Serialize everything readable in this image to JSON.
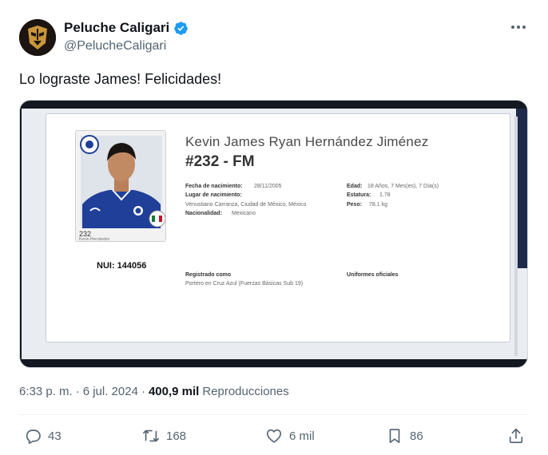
{
  "author": {
    "display_name": "Peluche Caligari",
    "handle": "@PelucheCaligari",
    "verified": true
  },
  "tweet": {
    "text": "Lo lograste James! Felicidades!"
  },
  "media": {
    "full_name": "Kevin James Ryan Hernández Jiménez",
    "number_position": "#232 - FM",
    "sticker_number": "232",
    "sticker_name": "Kevin Hernández",
    "nui": "NUI: 144056",
    "fields": {
      "birth_date_label": "Fecha de nacimiento:",
      "birth_date_value": "28/11/2005",
      "birth_place_label": "Lugar de nacimiento:",
      "birth_place_value": "Venustiano Carranza, Ciudad de México, México",
      "nationality_label": "Nacionalidad:",
      "nationality_value": "Mexicano",
      "age_label": "Edad:",
      "age_value": "18 Años, 7 Mes(es), 7 Día(s)",
      "height_label": "Estatura:",
      "height_value": "1.78",
      "weight_label": "Peso:",
      "weight_value": "78.1 kg",
      "registered_label": "Registrado como",
      "registered_value": "Portero en Cruz Azul (Fuerzas Básicas Sub 19)",
      "uniforms_label": "Uniformes oficiales"
    }
  },
  "meta": {
    "time": "6:33 p. m.",
    "separator1": "·",
    "date": "6 jul. 2024",
    "separator2": "·",
    "views_count": "400,9 mil",
    "views_label": "Reproducciones"
  },
  "actions": {
    "replies": "43",
    "retweets": "168",
    "likes": "6 mil",
    "bookmarks": "86"
  },
  "colors": {
    "verified": "#1d9bf0",
    "secondary_text": "#536471",
    "primary_text": "#0f1419"
  }
}
